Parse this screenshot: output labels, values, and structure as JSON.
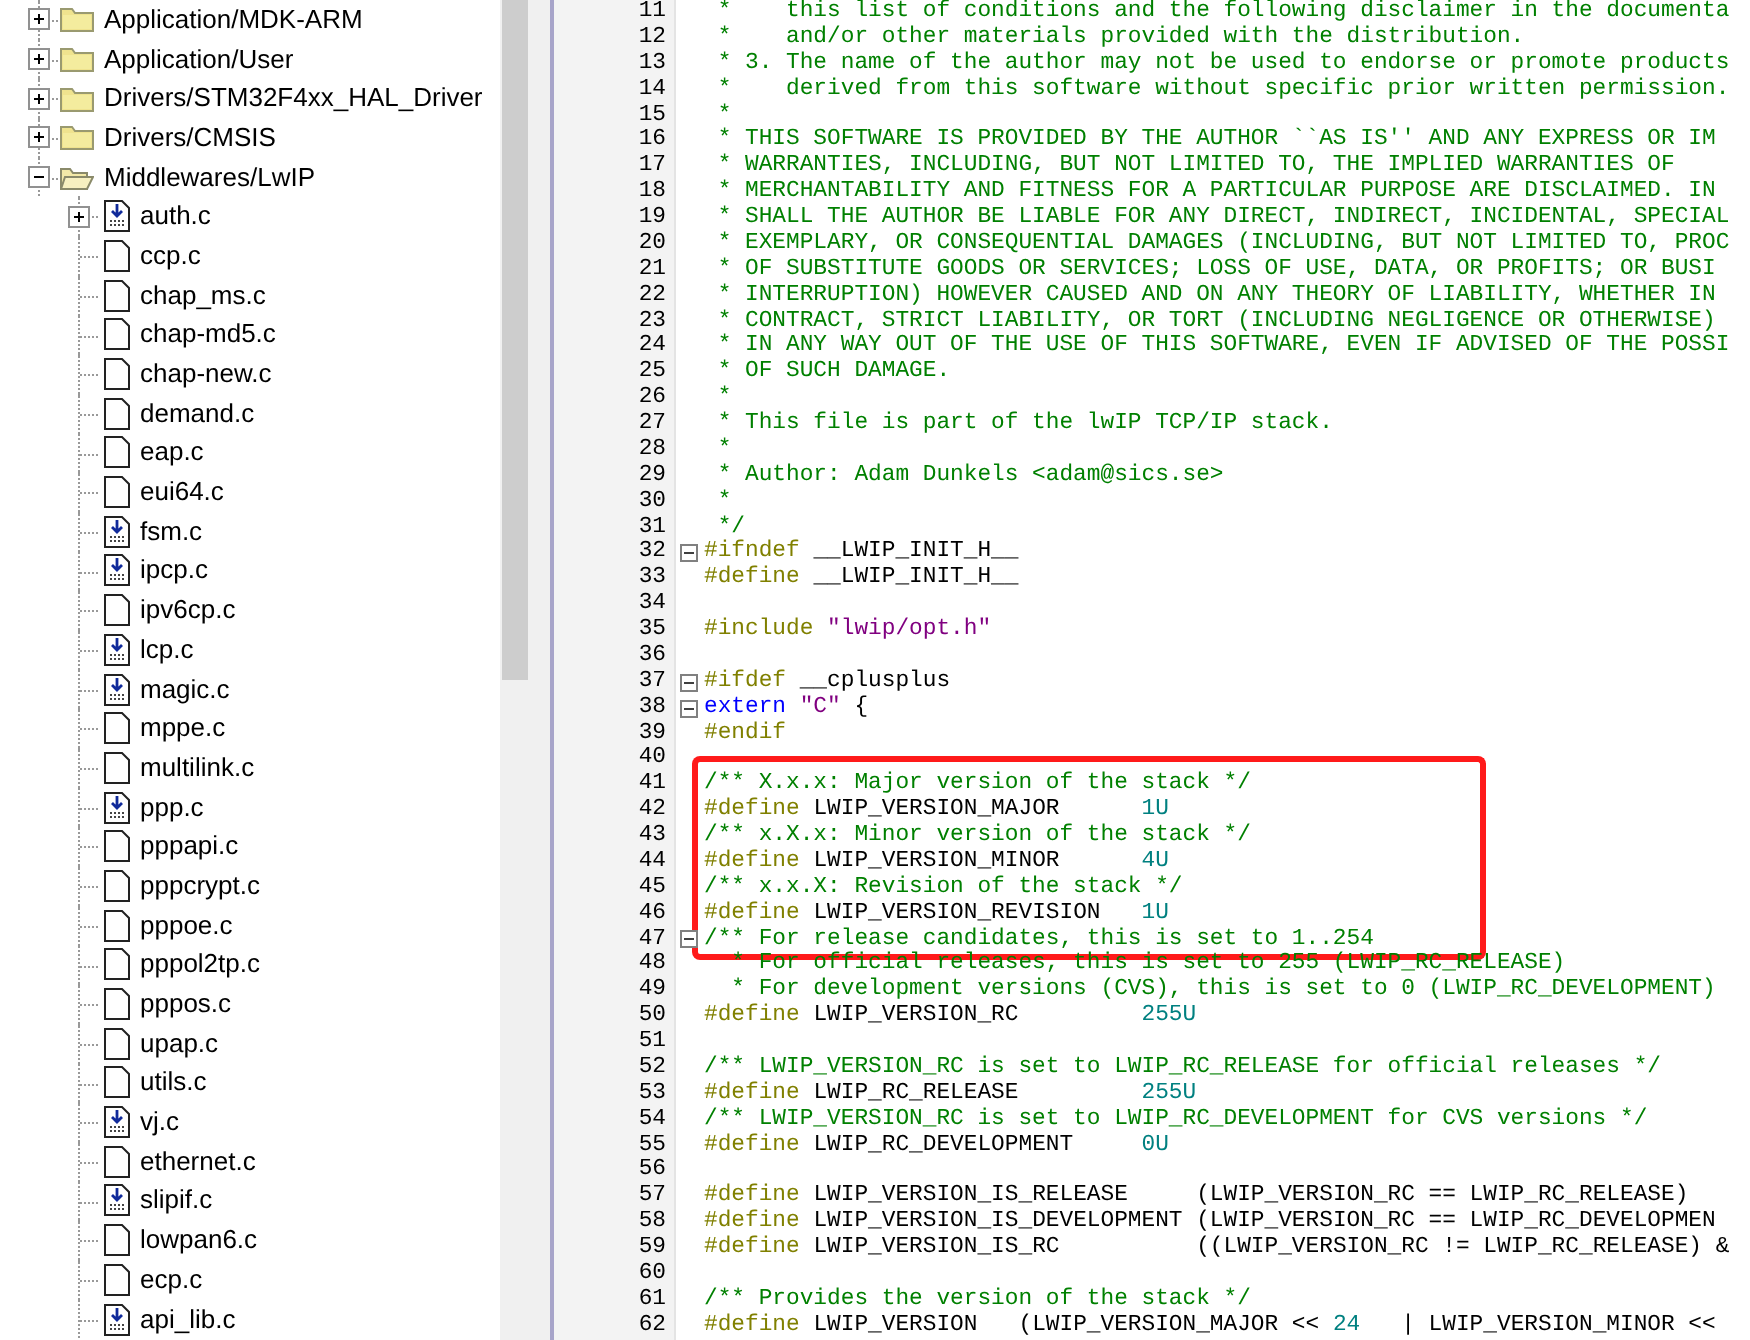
{
  "project_tree": [
    {
      "kind": "folder",
      "label": "Application/MDK-ARM",
      "expanded": false
    },
    {
      "kind": "folder",
      "label": "Application/User",
      "expanded": false
    },
    {
      "kind": "folder",
      "label": "Drivers/STM32F4xx_HAL_Driver",
      "expanded": false
    },
    {
      "kind": "folder",
      "label": "Drivers/CMSIS",
      "expanded": false
    },
    {
      "kind": "folder",
      "label": "Middlewares/LwIP",
      "expanded": true,
      "children": [
        {
          "kind": "file-include",
          "label": "auth.c",
          "expanded": false
        },
        {
          "kind": "file",
          "label": "ccp.c"
        },
        {
          "kind": "file",
          "label": "chap_ms.c"
        },
        {
          "kind": "file",
          "label": "chap-md5.c"
        },
        {
          "kind": "file",
          "label": "chap-new.c"
        },
        {
          "kind": "file",
          "label": "demand.c"
        },
        {
          "kind": "file",
          "label": "eap.c"
        },
        {
          "kind": "file",
          "label": "eui64.c"
        },
        {
          "kind": "file-include",
          "label": "fsm.c"
        },
        {
          "kind": "file-include",
          "label": "ipcp.c"
        },
        {
          "kind": "file",
          "label": "ipv6cp.c"
        },
        {
          "kind": "file-include",
          "label": "lcp.c"
        },
        {
          "kind": "file-include",
          "label": "magic.c"
        },
        {
          "kind": "file",
          "label": "mppe.c"
        },
        {
          "kind": "file",
          "label": "multilink.c"
        },
        {
          "kind": "file-include",
          "label": "ppp.c"
        },
        {
          "kind": "file",
          "label": "pppapi.c"
        },
        {
          "kind": "file",
          "label": "pppcrypt.c"
        },
        {
          "kind": "file",
          "label": "pppoe.c"
        },
        {
          "kind": "file",
          "label": "pppol2tp.c"
        },
        {
          "kind": "file",
          "label": "pppos.c"
        },
        {
          "kind": "file",
          "label": "upap.c"
        },
        {
          "kind": "file",
          "label": "utils.c"
        },
        {
          "kind": "file-include",
          "label": "vj.c"
        },
        {
          "kind": "file",
          "label": "ethernet.c"
        },
        {
          "kind": "file-include",
          "label": "slipif.c"
        },
        {
          "kind": "file",
          "label": "lowpan6.c"
        },
        {
          "kind": "file",
          "label": "ecp.c"
        },
        {
          "kind": "file-include",
          "label": "api_lib.c"
        }
      ]
    }
  ],
  "editor": {
    "lines": [
      {
        "number": "11",
        "collapsible": false,
        "highlighted": false,
        "code": [
          {
            "kind": "comment",
            "text": " *    this list of conditions and the following disclaimer in the documenta"
          }
        ]
      },
      {
        "number": "12",
        "collapsible": false,
        "highlighted": false,
        "code": [
          {
            "kind": "comment",
            "text": " *    and/or other materials provided with the distribution."
          }
        ]
      },
      {
        "number": "13",
        "collapsible": false,
        "highlighted": false,
        "code": [
          {
            "kind": "comment",
            "text": " * 3. The name of the author may not be used to endorse or promote products"
          }
        ]
      },
      {
        "number": "14",
        "collapsible": false,
        "highlighted": false,
        "code": [
          {
            "kind": "comment",
            "text": " *    derived from this software without specific prior written permission."
          }
        ]
      },
      {
        "number": "15",
        "collapsible": false,
        "highlighted": false,
        "code": [
          {
            "kind": "comment",
            "text": " *"
          }
        ]
      },
      {
        "number": "16",
        "collapsible": false,
        "highlighted": false,
        "code": [
          {
            "kind": "comment",
            "text": " * THIS SOFTWARE IS PROVIDED BY THE AUTHOR ``AS IS'' AND ANY EXPRESS OR IM"
          }
        ]
      },
      {
        "number": "17",
        "collapsible": false,
        "highlighted": false,
        "code": [
          {
            "kind": "comment",
            "text": " * WARRANTIES, INCLUDING, BUT NOT LIMITED TO, THE IMPLIED WARRANTIES OF"
          }
        ]
      },
      {
        "number": "18",
        "collapsible": false,
        "highlighted": false,
        "code": [
          {
            "kind": "comment",
            "text": " * MERCHANTABILITY AND FITNESS FOR A PARTICULAR PURPOSE ARE DISCLAIMED. IN"
          }
        ]
      },
      {
        "number": "19",
        "collapsible": false,
        "highlighted": false,
        "code": [
          {
            "kind": "comment",
            "text": " * SHALL THE AUTHOR BE LIABLE FOR ANY DIRECT, INDIRECT, INCIDENTAL, SPECIAL"
          }
        ]
      },
      {
        "number": "20",
        "collapsible": false,
        "highlighted": false,
        "code": [
          {
            "kind": "comment",
            "text": " * EXEMPLARY, OR CONSEQUENTIAL DAMAGES (INCLUDING, BUT NOT LIMITED TO, PROC"
          }
        ]
      },
      {
        "number": "21",
        "collapsible": false,
        "highlighted": false,
        "code": [
          {
            "kind": "comment",
            "text": " * OF SUBSTITUTE GOODS OR SERVICES; LOSS OF USE, DATA, OR PROFITS; OR BUSI"
          }
        ]
      },
      {
        "number": "22",
        "collapsible": false,
        "highlighted": false,
        "code": [
          {
            "kind": "comment",
            "text": " * INTERRUPTION) HOWEVER CAUSED AND ON ANY THEORY OF LIABILITY, WHETHER IN"
          }
        ]
      },
      {
        "number": "23",
        "collapsible": false,
        "highlighted": false,
        "code": [
          {
            "kind": "comment",
            "text": " * CONTRACT, STRICT LIABILITY, OR TORT (INCLUDING NEGLIGENCE OR OTHERWISE)"
          }
        ]
      },
      {
        "number": "24",
        "collapsible": false,
        "highlighted": false,
        "code": [
          {
            "kind": "comment",
            "text": " * IN ANY WAY OUT OF THE USE OF THIS SOFTWARE, EVEN IF ADVISED OF THE POSSI"
          }
        ]
      },
      {
        "number": "25",
        "collapsible": false,
        "highlighted": false,
        "code": [
          {
            "kind": "comment",
            "text": " * OF SUCH DAMAGE."
          }
        ]
      },
      {
        "number": "26",
        "collapsible": false,
        "highlighted": false,
        "code": [
          {
            "kind": "comment",
            "text": " *"
          }
        ]
      },
      {
        "number": "27",
        "collapsible": false,
        "highlighted": false,
        "code": [
          {
            "kind": "comment",
            "text": " * This file is part of the lwIP TCP/IP stack."
          }
        ]
      },
      {
        "number": "28",
        "collapsible": false,
        "highlighted": false,
        "code": [
          {
            "kind": "comment",
            "text": " *"
          }
        ]
      },
      {
        "number": "29",
        "collapsible": false,
        "highlighted": false,
        "code": [
          {
            "kind": "comment",
            "text": " * Author: Adam Dunkels <adam@sics.se>"
          }
        ]
      },
      {
        "number": "30",
        "collapsible": false,
        "highlighted": false,
        "code": [
          {
            "kind": "comment",
            "text": " *"
          }
        ]
      },
      {
        "number": "31",
        "collapsible": false,
        "highlighted": false,
        "code": [
          {
            "kind": "comment",
            "text": " */"
          }
        ]
      },
      {
        "number": "32",
        "collapsible": true,
        "highlighted": false,
        "code": [
          {
            "kind": "preprocessor",
            "text": "#ifndef"
          },
          {
            "kind": "plain",
            "text": " __LWIP_INIT_H__"
          }
        ]
      },
      {
        "number": "33",
        "collapsible": false,
        "highlighted": false,
        "code": [
          {
            "kind": "preprocessor",
            "text": "#define"
          },
          {
            "kind": "plain",
            "text": " __LWIP_INIT_H__"
          }
        ]
      },
      {
        "number": "34",
        "collapsible": false,
        "highlighted": false
      },
      {
        "number": "35",
        "collapsible": false,
        "highlighted": false,
        "code": [
          {
            "kind": "preprocessor",
            "text": "#include"
          },
          {
            "kind": "string",
            "text": " \"lwip/opt.h\""
          }
        ]
      },
      {
        "number": "36",
        "collapsible": false,
        "highlighted": false
      },
      {
        "number": "37",
        "collapsible": true,
        "highlighted": false,
        "code": [
          {
            "kind": "preprocessor",
            "text": "#ifdef"
          },
          {
            "kind": "plain",
            "text": " __cplusplus"
          }
        ]
      },
      {
        "number": "38",
        "collapsible": true,
        "highlighted": false,
        "code": [
          {
            "kind": "keyword",
            "text": "extern"
          },
          {
            "kind": "string",
            "text": " \"C\""
          },
          {
            "kind": "plain",
            "text": " {"
          }
        ]
      },
      {
        "number": "39",
        "collapsible": false,
        "highlighted": false,
        "code": [
          {
            "kind": "preprocessor",
            "text": "#endif"
          }
        ]
      },
      {
        "number": "40",
        "collapsible": false,
        "highlighted": false
      },
      {
        "number": "41",
        "collapsible": false,
        "highlighted": true,
        "code": [
          {
            "kind": "comment",
            "text": "/** X.x.x: Major version of the stack */"
          }
        ]
      },
      {
        "number": "42",
        "collapsible": false,
        "highlighted": true,
        "code": [
          {
            "kind": "preprocessor",
            "text": "#define"
          },
          {
            "kind": "plain",
            "text": " LWIP_VERSION_MAJOR      "
          },
          {
            "kind": "number",
            "text": "1U"
          }
        ]
      },
      {
        "number": "43",
        "collapsible": false,
        "highlighted": true,
        "code": [
          {
            "kind": "comment",
            "text": "/** x.X.x: Minor version of the stack */"
          }
        ]
      },
      {
        "number": "44",
        "collapsible": false,
        "highlighted": true,
        "code": [
          {
            "kind": "preprocessor",
            "text": "#define"
          },
          {
            "kind": "plain",
            "text": " LWIP_VERSION_MINOR      "
          },
          {
            "kind": "number",
            "text": "4U"
          }
        ]
      },
      {
        "number": "45",
        "collapsible": false,
        "highlighted": true,
        "code": [
          {
            "kind": "comment",
            "text": "/** x.x.X: Revision of the stack */"
          }
        ]
      },
      {
        "number": "46",
        "collapsible": false,
        "highlighted": true,
        "code": [
          {
            "kind": "preprocessor",
            "text": "#define"
          },
          {
            "kind": "plain",
            "text": " LWIP_VERSION_REVISION   "
          },
          {
            "kind": "number",
            "text": "1U"
          }
        ]
      },
      {
        "number": "47",
        "collapsible": true,
        "highlighted": true,
        "code": [
          {
            "kind": "comment",
            "text": "/** For release candidates, this is set to 1..254"
          }
        ]
      },
      {
        "number": "48",
        "collapsible": false,
        "highlighted": false,
        "code": [
          {
            "kind": "comment",
            "text": "  * For official releases, this is set to 255 (LWIP_RC_RELEASE)"
          }
        ]
      },
      {
        "number": "49",
        "collapsible": false,
        "highlighted": false,
        "code": [
          {
            "kind": "comment",
            "text": "  * For development versions (CVS), this is set to 0 (LWIP_RC_DEVELOPMENT)"
          }
        ]
      },
      {
        "number": "50",
        "collapsible": false,
        "highlighted": false,
        "code": [
          {
            "kind": "preprocessor",
            "text": "#define"
          },
          {
            "kind": "plain",
            "text": " LWIP_VERSION_RC         "
          },
          {
            "kind": "number",
            "text": "255U"
          }
        ]
      },
      {
        "number": "51",
        "collapsible": false,
        "highlighted": false
      },
      {
        "number": "52",
        "collapsible": false,
        "highlighted": false,
        "code": [
          {
            "kind": "comment",
            "text": "/** LWIP_VERSION_RC is set to LWIP_RC_RELEASE for official releases */"
          }
        ]
      },
      {
        "number": "53",
        "collapsible": false,
        "highlighted": false,
        "code": [
          {
            "kind": "preprocessor",
            "text": "#define"
          },
          {
            "kind": "plain",
            "text": " LWIP_RC_RELEASE         "
          },
          {
            "kind": "number",
            "text": "255U"
          }
        ]
      },
      {
        "number": "54",
        "collapsible": false,
        "highlighted": false,
        "code": [
          {
            "kind": "comment",
            "text": "/** LWIP_VERSION_RC is set to LWIP_RC_DEVELOPMENT for CVS versions */"
          }
        ]
      },
      {
        "number": "55",
        "collapsible": false,
        "highlighted": false,
        "code": [
          {
            "kind": "preprocessor",
            "text": "#define"
          },
          {
            "kind": "plain",
            "text": " LWIP_RC_DEVELOPMENT     "
          },
          {
            "kind": "number",
            "text": "0U"
          }
        ]
      },
      {
        "number": "56",
        "collapsible": false,
        "highlighted": false
      },
      {
        "number": "57",
        "collapsible": false,
        "highlighted": false,
        "code": [
          {
            "kind": "preprocessor",
            "text": "#define"
          },
          {
            "kind": "plain",
            "text": " LWIP_VERSION_IS_RELEASE     (LWIP_VERSION_RC == LWIP_RC_RELEASE)"
          }
        ]
      },
      {
        "number": "58",
        "collapsible": false,
        "highlighted": false,
        "code": [
          {
            "kind": "preprocessor",
            "text": "#define"
          },
          {
            "kind": "plain",
            "text": " LWIP_VERSION_IS_DEVELOPMENT (LWIP_VERSION_RC == LWIP_RC_DEVELOPMEN"
          }
        ]
      },
      {
        "number": "59",
        "collapsible": false,
        "highlighted": false,
        "code": [
          {
            "kind": "preprocessor",
            "text": "#define"
          },
          {
            "kind": "plain",
            "text": " LWIP_VERSION_IS_RC          ((LWIP_VERSION_RC != LWIP_RC_RELEASE) &"
          }
        ]
      },
      {
        "number": "60",
        "collapsible": false,
        "highlighted": false
      },
      {
        "number": "61",
        "collapsible": false,
        "highlighted": false,
        "code": [
          {
            "kind": "comment",
            "text": "/** Provides the version of the stack */"
          }
        ]
      },
      {
        "number": "62",
        "collapsible": false,
        "highlighted": false,
        "code": [
          {
            "kind": "preprocessor",
            "text": "#define"
          },
          {
            "kind": "plain",
            "text": " LWIP_VERSION   (LWIP_VERSION_MAJOR << "
          },
          {
            "kind": "number",
            "text": "24"
          },
          {
            "kind": "plain",
            "text": "   | LWIP_VERSION_MINOR <<"
          }
        ]
      }
    ]
  }
}
